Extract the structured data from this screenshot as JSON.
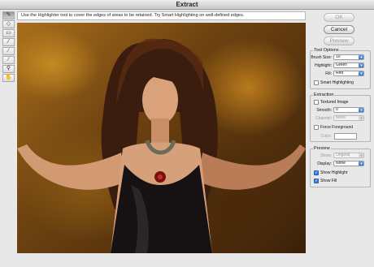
{
  "window": {
    "title": "Extract"
  },
  "hint_text": "Use the Highlighter tool to cover the edges of areas to be retained. Try Smart Highlighting on well-defined edges.",
  "tools": [
    {
      "name": "edge-highlighter-tool",
      "icon": "pencil-icon",
      "glyph": "✎"
    },
    {
      "name": "fill-tool",
      "icon": "paint-bucket-icon",
      "glyph": "◇"
    },
    {
      "name": "eraser-tool",
      "icon": "eraser-icon",
      "glyph": "▭"
    },
    {
      "name": "eyedropper-tool",
      "icon": "eyedropper-icon",
      "glyph": "⁄"
    },
    {
      "name": "cleanup-tool",
      "icon": "cleanup-icon",
      "glyph": "∕"
    },
    {
      "name": "edge-touchup-tool",
      "icon": "touchup-icon",
      "glyph": "∕"
    },
    {
      "name": "zoom-tool",
      "icon": "magnifier-icon",
      "glyph": "⚲"
    },
    {
      "name": "hand-tool",
      "icon": "hand-icon",
      "glyph": "✋"
    }
  ],
  "buttons": {
    "ok": "OK",
    "cancel": "Cancel",
    "preview": "Preview"
  },
  "tool_options": {
    "title": "Tool Options",
    "brush_size_label": "Brush Size:",
    "brush_size_value": "10",
    "highlight_label": "Highlight:",
    "highlight_value": "Green",
    "fill_label": "Fill:",
    "fill_value": "Red",
    "smart_highlighting_label": "Smart Highlighting",
    "smart_highlighting_checked": false
  },
  "extraction": {
    "title": "Extraction",
    "textured_image_label": "Textured Image",
    "textured_image_checked": false,
    "smooth_label": "Smooth:",
    "smooth_value": "0",
    "channel_label": "Channel:",
    "channel_value": "None",
    "force_foreground_label": "Force Foreground",
    "force_foreground_checked": false,
    "color_label": "Color:"
  },
  "preview": {
    "title": "Preview",
    "show_label": "Show:",
    "show_value": "Original",
    "display_label": "Display:",
    "display_value": "None",
    "show_highlight_label": "Show Highlight",
    "show_highlight_checked": true,
    "show_fill_label": "Show Fill",
    "show_fill_checked": true
  }
}
